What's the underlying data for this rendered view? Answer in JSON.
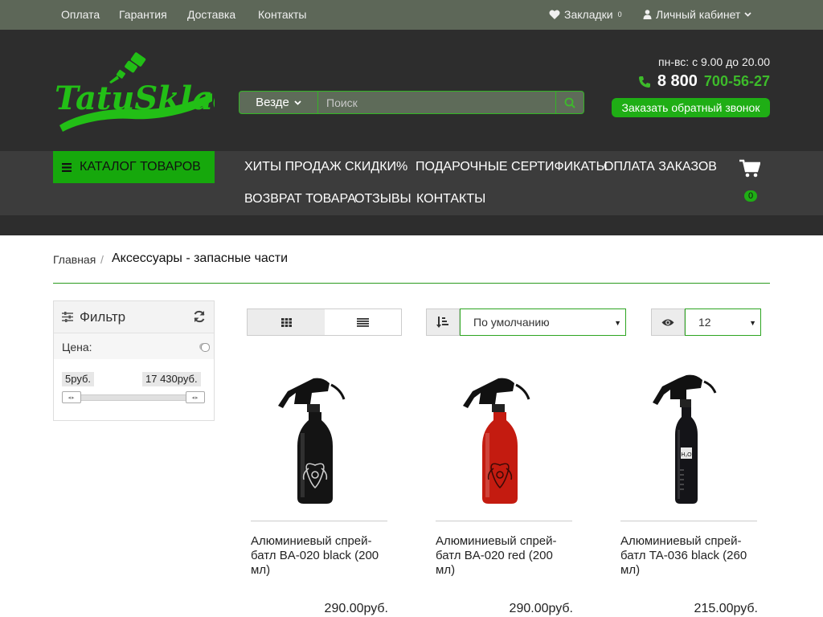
{
  "topbar": {
    "links": [
      "Оплата",
      "Гарантия",
      "Доставка",
      "Контакты"
    ],
    "bookmarks_label": "Закладки",
    "bookmarks_count": "0",
    "account_label": "Личный кабинет"
  },
  "header": {
    "logo_text": "TatuSklad",
    "search": {
      "scope": "Везде",
      "placeholder": "Поиск"
    },
    "hours": "пн-вс: с 9.00 до 20.00",
    "phone_prefix": "8 800",
    "phone_number": "700-56-27",
    "callback_label": "Заказать обратный звонок"
  },
  "nav": {
    "catalog_label": "КАТАЛОГ ТОВАРОВ",
    "links": [
      "ХИТЫ ПРОДАЖ",
      "СКИДКИ%",
      "ПОДАРОЧНЫЕ СЕРТИФИКАТЫ",
      "ОПЛАТА ЗАКАЗОВ",
      "ВОЗВРАТ ТОВАРА",
      "ОТЗЫВЫ",
      "КОНТАКТЫ"
    ],
    "cart_count": "0"
  },
  "breadcrumb": {
    "home": "Главная",
    "separator": "/",
    "current": "Аксессуары - запасные части"
  },
  "filter": {
    "title": "Фильтр",
    "price_label": "Цена:",
    "price_min": "5руб.",
    "price_max": "17 430руб."
  },
  "toolbar": {
    "sort_value": "По умолчанию",
    "limit_value": "12"
  },
  "products": [
    {
      "name": "Алюминиевый спрей-батл BA-020 black (200 мл)",
      "price": "290.00руб.",
      "bottle_color": "#141414",
      "label": "dragon"
    },
    {
      "name": "Алюминиевый спрей-батл BA-020 red (200 мл)",
      "price": "290.00руб.",
      "bottle_color": "#c41b10",
      "label": "dragon"
    },
    {
      "name": "Алюминиевый спрей-батл TA-036 black (260 мл)",
      "price": "215.00руб.",
      "bottle_color": "#141418",
      "label": "H₂O"
    }
  ],
  "colors": {
    "accent_green": "#1fae15",
    "topbar": "#5d6758",
    "header": "#2d2d2d",
    "nav": "#3c3c3c"
  }
}
